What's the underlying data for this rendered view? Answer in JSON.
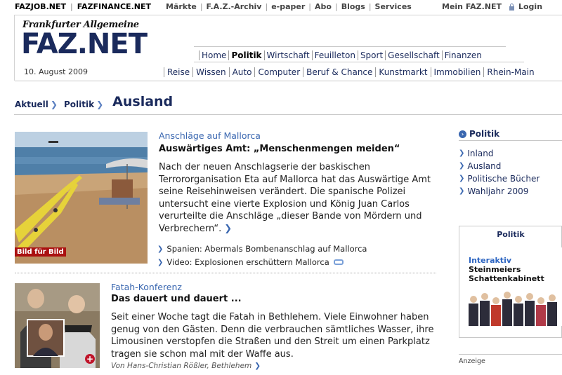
{
  "topbar": {
    "brands": [
      "FAZJOB.NET",
      "FAZFINANCE.NET"
    ],
    "links": [
      "Märkte",
      "F.A.Z.-Archiv",
      "e-paper",
      "Abo",
      "Blogs",
      "Services"
    ],
    "account": "Mein FAZ.NET",
    "login": "Login"
  },
  "header": {
    "logo_small": "Frankfurter Allgemeine",
    "logo_big": "FAZ.NET",
    "date": "10. August 2009",
    "nav_primary": [
      "Home",
      "Politik",
      "Wirtschaft",
      "Feuilleton",
      "Sport",
      "Gesellschaft",
      "Finanzen"
    ],
    "nav_primary_active": "Politik",
    "nav_secondary": [
      "Reise",
      "Wissen",
      "Auto",
      "Computer",
      "Beruf & Chance",
      "Kunstmarkt",
      "Immobilien",
      "Rhein-Main"
    ]
  },
  "breadcrumb": {
    "items": [
      "Aktuell",
      "Politik"
    ],
    "current": "Ausland"
  },
  "article1": {
    "image_badge": "Bild für Bild",
    "kicker": "Anschläge auf Mallorca",
    "headline": "Auswärtiges Amt: „Menschenmengen meiden“",
    "teaser_lines": [
      "Nach der neuen Anschlagserie der baskischen",
      "Terrororganisation Eta auf Mallorca hat das Auswärtige Amt",
      "seine Reisehinweisen verändert. Die spanische Polizei",
      "untersucht eine vierte Explosion und König Juan Carlos",
      "verurteilte die Anschläge „dieser Bande von Mördern und",
      "Verbrechern“."
    ],
    "related": [
      "Spanien: Abermals Bombenanschlag auf Mallorca",
      "Video: Explosionen erschüttern Mallorca"
    ]
  },
  "article2": {
    "kicker": "Fatah-Konferenz",
    "headline": "Das dauert und dauert ...",
    "teaser_lines": [
      "Seit einer Woche tagt die Fatah in Bethlehem. Viele Einwohner haben",
      "genug von den Gästen. Denn die verbrauchen sämtliches Wasser, ihre",
      "Limousinen verstopfen die Straßen und den Streit um einen Parkplatz",
      "tragen sie schon mal mit der Waffe aus."
    ],
    "author": "Von Hans-Christian Rößler, Bethlehem",
    "plus": "+"
  },
  "sidebar": {
    "title": "Politik",
    "items": [
      "Inland",
      "Ausland",
      "Politische Bücher",
      "Wahljahr 2009"
    ],
    "box_title": "Politik",
    "box_kicker": "Interaktiv",
    "box_headline_lines": [
      "Steinmeiers",
      "Schattenkabinett"
    ],
    "ad_label": "Anzeige"
  },
  "colors": {
    "brand_navy": "#1a2a5c",
    "link_blue": "#3a67b0",
    "badge_red": "#a11111"
  }
}
